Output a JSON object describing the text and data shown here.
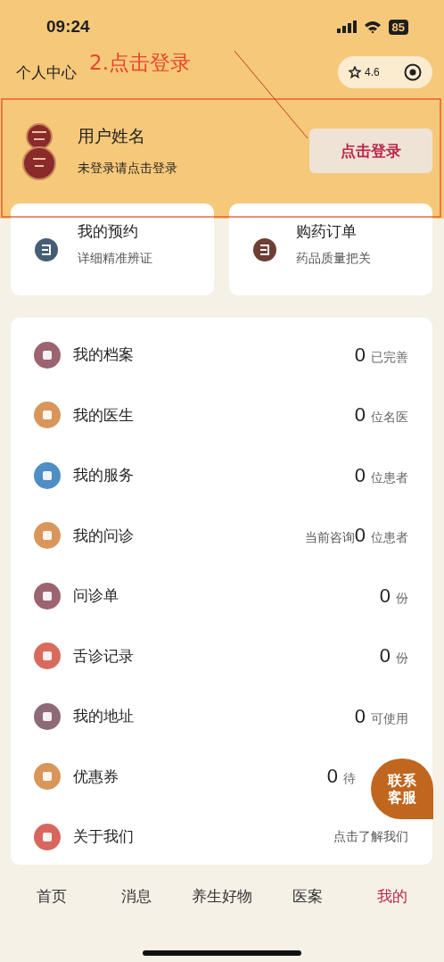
{
  "status_bar": {
    "time": "09:24",
    "battery": "85"
  },
  "header": {
    "title": "个人中心",
    "rating": "4.6"
  },
  "annotation": {
    "label": "2.点击登录"
  },
  "profile": {
    "name": "用户姓名",
    "hint": "未登录请点击登录",
    "login_button": "点击登录"
  },
  "quick_cards": [
    {
      "title": "我的预约",
      "subtitle": "详细精准辨证",
      "color": "#475d73"
    },
    {
      "title": "购药订单",
      "subtitle": "药品质量把关",
      "color": "#6e3e36"
    }
  ],
  "menu": [
    {
      "label": "我的档案",
      "color": "#9b6470",
      "count": "0",
      "suffix": "已完善"
    },
    {
      "label": "我的医生",
      "color": "#d9965a",
      "count": "0",
      "suffix": "位名医"
    },
    {
      "label": "我的服务",
      "color": "#4f8ec4",
      "count": "0",
      "suffix": "位患者"
    },
    {
      "label": "我的问诊",
      "color": "#d9965a",
      "prefix": "当前咨询",
      "count": "0",
      "suffix": "位患者"
    },
    {
      "label": "问诊单",
      "color": "#9b6470",
      "count": "0",
      "suffix": "份"
    },
    {
      "label": "舌诊记录",
      "color": "#d96a5e",
      "count": "0",
      "suffix": "份"
    },
    {
      "label": "我的地址",
      "color": "#8e6a78",
      "count": "0",
      "suffix": "可使用"
    },
    {
      "label": "优惠券",
      "color": "#d9965a",
      "count": "0",
      "suffix": "待",
      "cut_by_button": true
    },
    {
      "label": "关于我们",
      "color": "#d9655f",
      "note": "点击了解我们"
    }
  ],
  "float_button": {
    "label": "联系客服"
  },
  "tabs": [
    {
      "label": "首页",
      "selected": false
    },
    {
      "label": "消息",
      "selected": false
    },
    {
      "label": "养生好物",
      "selected": false
    },
    {
      "label": "医案",
      "selected": false
    },
    {
      "label": "我的",
      "selected": true
    }
  ]
}
